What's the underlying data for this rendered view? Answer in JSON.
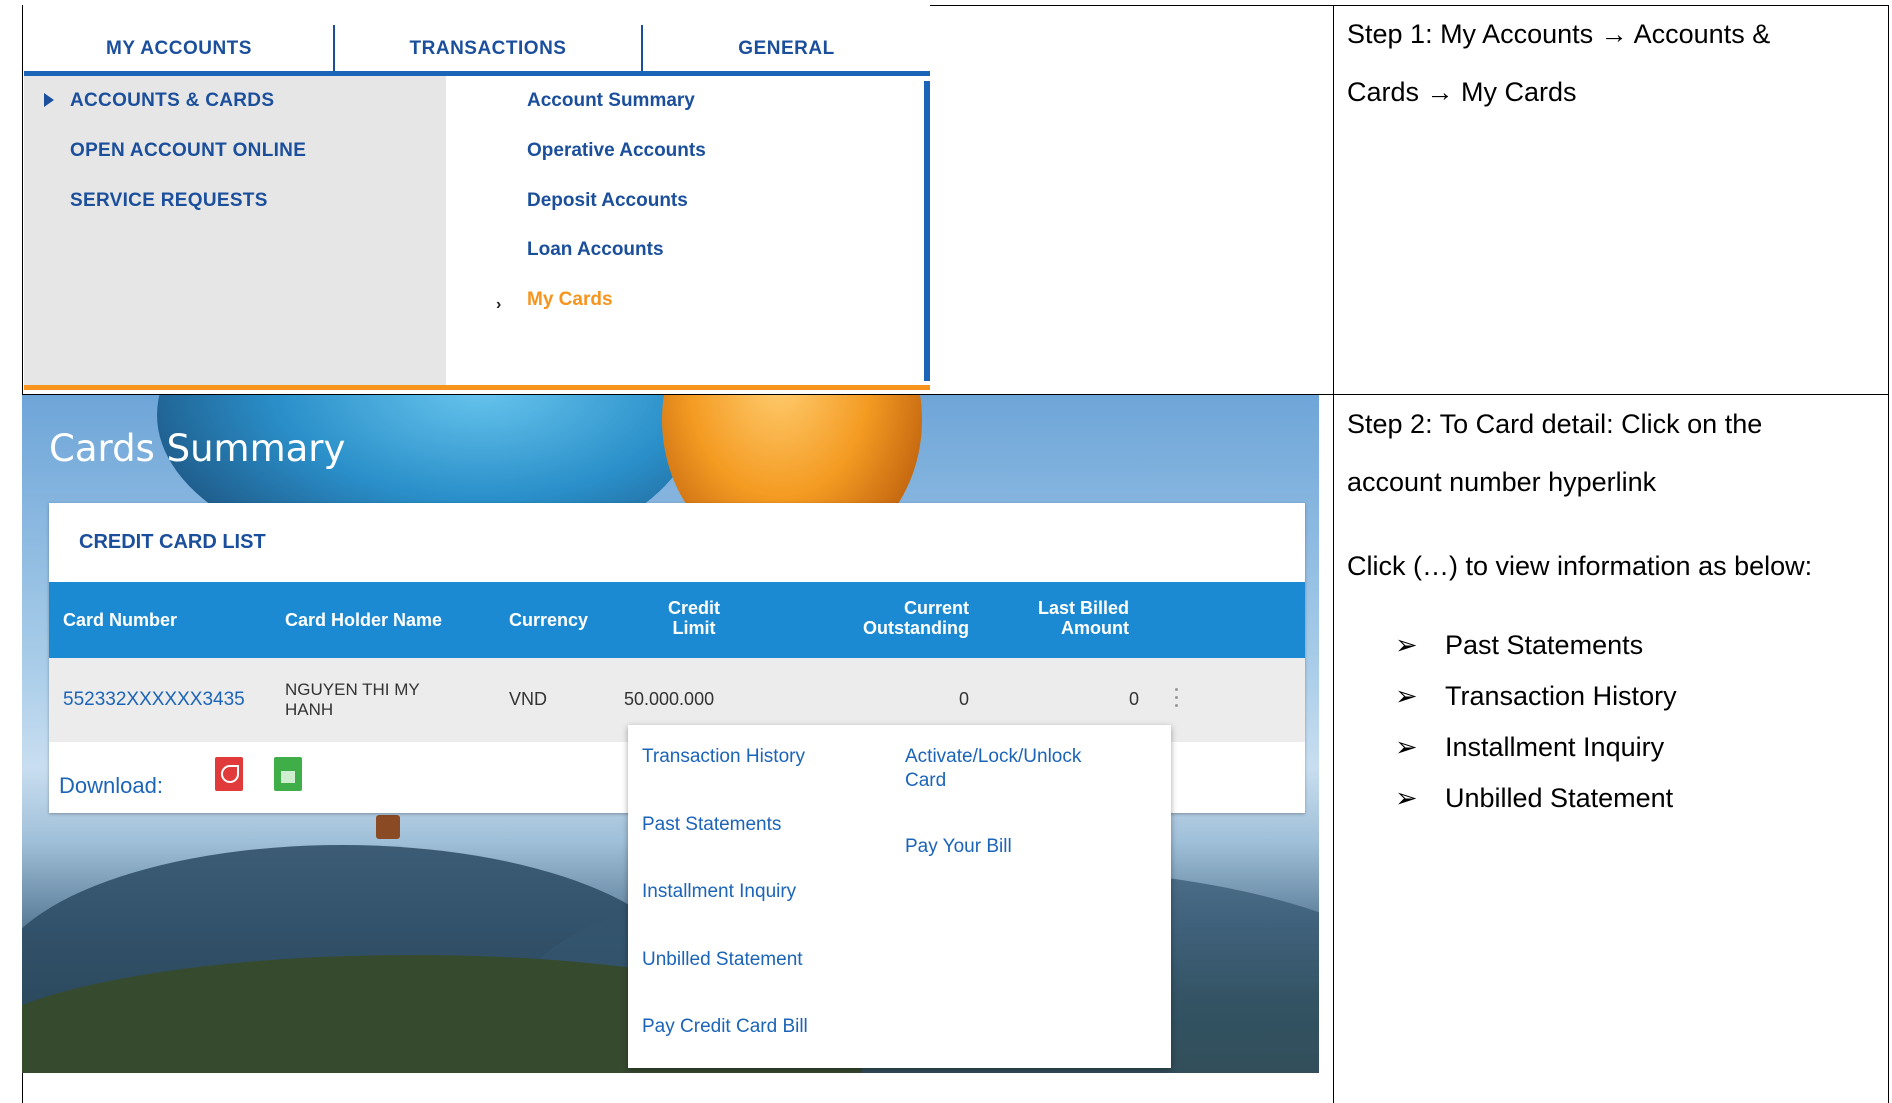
{
  "menu": {
    "tabs": [
      "MY ACCOUNTS",
      "TRANSACTIONS",
      "GENERAL"
    ],
    "left_items": [
      "ACCOUNTS & CARDS",
      "OPEN ACCOUNT ONLINE",
      "SERVICE REQUESTS"
    ],
    "right_items": [
      "Account Summary",
      "Operative Accounts",
      "Deposit Accounts",
      "Loan Accounts",
      "My Cards"
    ],
    "active_left": "ACCOUNTS & CARDS",
    "active_right": "My Cards",
    "colors": {
      "brand_blue": "#1b4f9c",
      "accent_orange": "#f7941d"
    }
  },
  "step1": {
    "label": "Step 1",
    "line1": ": My Accounts → Accounts &",
    "line2": "Cards → My Cards"
  },
  "cards": {
    "page_title": "Cards Summary",
    "list_title": "CREDIT CARD LIST",
    "columns": {
      "card_number": "Card Number",
      "holder": "Card Holder Name",
      "currency": "Currency",
      "credit_limit_1": "Credit",
      "credit_limit_2": "Limit",
      "outstanding_1": "Current",
      "outstanding_2": "Outstanding",
      "billed_1": "Last Billed",
      "billed_2": "Amount"
    },
    "row": {
      "card_number": "552332XXXXXX3435",
      "holder_1": "NGUYEN THI MY",
      "holder_2": "HANH",
      "currency": "VND",
      "credit_limit": "50.000.000",
      "outstanding": "0",
      "billed": "0"
    },
    "download_label": "Download:",
    "download_icons": [
      "pdf-icon",
      "excel-icon"
    ],
    "actions_menu": {
      "col1": [
        "Transaction History",
        "Past Statements",
        "Installment Inquiry",
        "Unbilled Statement",
        "Pay Credit Card Bill"
      ],
      "col2_a1": "Activate/Lock/Unlock",
      "col2_a2": "Card",
      "col2_b": "Pay Your Bill"
    },
    "colors": {
      "header_blue": "#1b8ad3",
      "link_blue": "#1b64b8"
    }
  },
  "step2": {
    "label": "Step 2",
    "line1": ":  To Card detail: Click on the",
    "line2": "account number hyperlink",
    "line3": "Click  (…) to view information as below:",
    "bullet_marker": "➢",
    "bullets": [
      "Past Statements",
      "Transaction History",
      "Installment Inquiry",
      "Unbilled Statement"
    ]
  }
}
